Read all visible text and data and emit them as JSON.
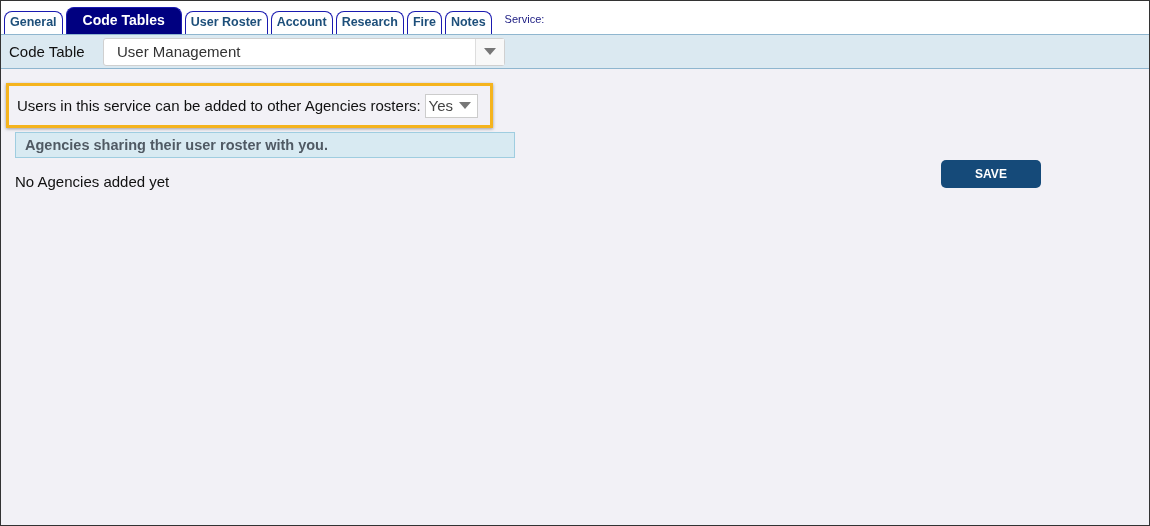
{
  "tabs": [
    {
      "label": "General",
      "selected": false
    },
    {
      "label": "Code Tables",
      "selected": true
    },
    {
      "label": "User Roster",
      "selected": false
    },
    {
      "label": "Account",
      "selected": false
    },
    {
      "label": "Research",
      "selected": false
    },
    {
      "label": "Fire",
      "selected": false
    },
    {
      "label": "Notes",
      "selected": false
    }
  ],
  "service_label": "Service:",
  "code_table": {
    "label": "Code Table",
    "value": "User Management"
  },
  "sharing_setting": {
    "label": "Users in this service can be added to other Agencies rosters:",
    "value": "Yes",
    "highlighted": true
  },
  "agencies_section": {
    "heading": "Agencies sharing their user roster with you.",
    "empty_message": "No Agencies added yet"
  },
  "save_button": "SAVE"
}
